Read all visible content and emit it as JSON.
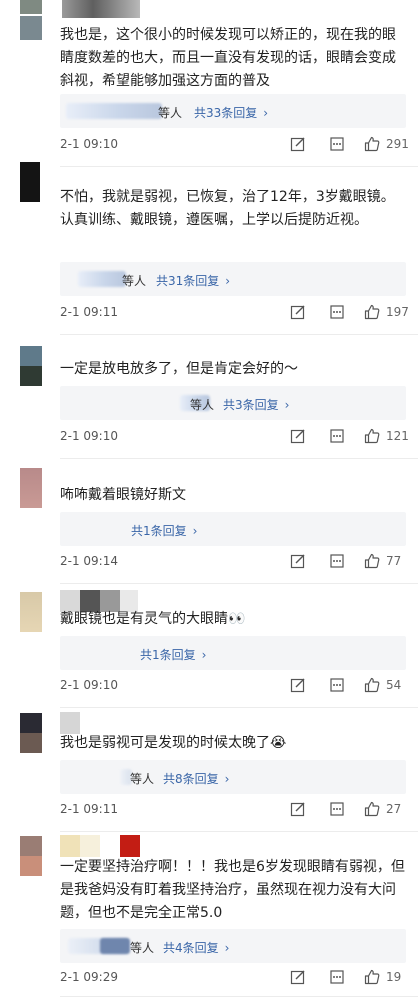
{
  "comments": [
    {
      "text": "我也是，这个很小的时候发现可以矫正的，现在我的眼睛度数差的也大，而且一直没有发现的话，眼睛会变成斜视，希望能够加强这方面的普及",
      "reply_who": "等人",
      "reply_link": "共33条回复",
      "date": "2-1 09:10",
      "likes": "291"
    },
    {
      "text": "不怕，我就是弱视，已恢复，治了12年，3岁戴眼镜。认真训练、戴眼镜，遵医嘱，上学以后提防近视。",
      "reply_who": "等人",
      "reply_link": "共31条回复",
      "date": "2-1 09:11",
      "likes": "197"
    },
    {
      "text": "一定是放电放多了，但是肯定会好的～",
      "reply_who": "等人",
      "reply_link": "共3条回复",
      "date": "2-1 09:10",
      "likes": "121"
    },
    {
      "text": "咘咘戴着眼镜好斯文",
      "reply_who": "",
      "reply_link": "共1条回复",
      "date": "2-1 09:14",
      "likes": "77"
    },
    {
      "text": "戴眼镜也是有灵气的大眼睛👀",
      "reply_who": "",
      "reply_link": "共1条回复",
      "date": "2-1 09:10",
      "likes": "54"
    },
    {
      "text": "我也是弱视可是发现的时候太晚了😭",
      "reply_who": "等人",
      "reply_link": "共8条回复",
      "date": "2-1 09:11",
      "likes": "27"
    },
    {
      "text": "一定要坚持治疗啊！！！我也是6岁发现眼睛有弱视，但是我爸妈没有盯着我坚持治疗，虽然现在视力没有大问题，但也不是完全正常5.0",
      "reply_who": "等人",
      "reply_link": "共4条回复",
      "date": "2-1 09:29",
      "likes": "19"
    }
  ],
  "icons": {
    "reply": "edit-icon",
    "more": "more-icon",
    "like": "thumbs-up-icon",
    "chevron": "chevron-right-icon"
  },
  "colors": {
    "link": "#3a66a8",
    "reply_bg": "#f4f5f7",
    "meta_text": "#555555"
  }
}
